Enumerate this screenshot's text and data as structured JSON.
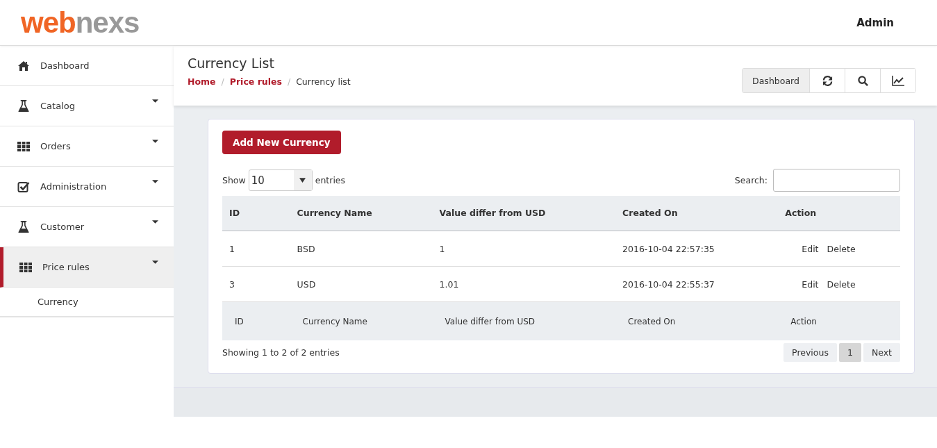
{
  "header": {
    "logo": {
      "first": "web",
      "second": "nexs"
    },
    "user": "Admin"
  },
  "sidebar": {
    "items": [
      {
        "label": "Dashboard",
        "kind": "home",
        "has_menu": false,
        "selected": false
      },
      {
        "label": "Catalog",
        "kind": "flask",
        "has_menu": true,
        "selected": false
      },
      {
        "label": "Orders",
        "kind": "grid",
        "has_menu": true,
        "selected": false
      },
      {
        "label": "Administration",
        "kind": "check",
        "has_menu": true,
        "selected": false
      },
      {
        "label": "Customer",
        "kind": "flask",
        "has_menu": true,
        "selected": false
      },
      {
        "label": "Price rules",
        "kind": "grid",
        "has_menu": true,
        "selected": true,
        "children": [
          {
            "label": "Currency"
          }
        ]
      }
    ]
  },
  "page": {
    "title": "Currency List",
    "breadcrumb_separator": "/",
    "breadcrumb": [
      {
        "label": "Home",
        "link": true
      },
      {
        "label": "Price rules",
        "link": true
      },
      {
        "label": "Currency list",
        "link": false
      }
    ],
    "toolbar": [
      {
        "kind": "text",
        "label": "Dashboard"
      },
      {
        "kind": "refresh"
      },
      {
        "kind": "search"
      },
      {
        "kind": "chart"
      }
    ]
  },
  "card": {
    "add_button": "Add New Currency",
    "show_label": "Show",
    "page_size": "10",
    "entries_label": "entries",
    "search_label": "Search:",
    "table": {
      "columns": [
        "ID",
        "Currency Name",
        "Value differ from USD",
        "Created On",
        "Action"
      ],
      "rows": [
        {
          "id": "1",
          "name": "BSD",
          "value": "1",
          "created": "2016-10-04 22:57:35",
          "actions": [
            "Edit",
            "Delete"
          ]
        },
        {
          "id": "3",
          "name": "USD",
          "value": "1.01",
          "created": "2016-10-04 22:55:37",
          "actions": [
            "Edit",
            "Delete"
          ]
        }
      ],
      "footer": [
        "ID",
        "Currency Name",
        "Value differ from USD",
        "Created On",
        "Action"
      ]
    },
    "info": "Showing 1 to 2 of 2 entries",
    "pagination": [
      {
        "label": "Previous",
        "selected": false
      },
      {
        "label": "1",
        "selected": true
      },
      {
        "label": "Next",
        "selected": false
      }
    ]
  }
}
